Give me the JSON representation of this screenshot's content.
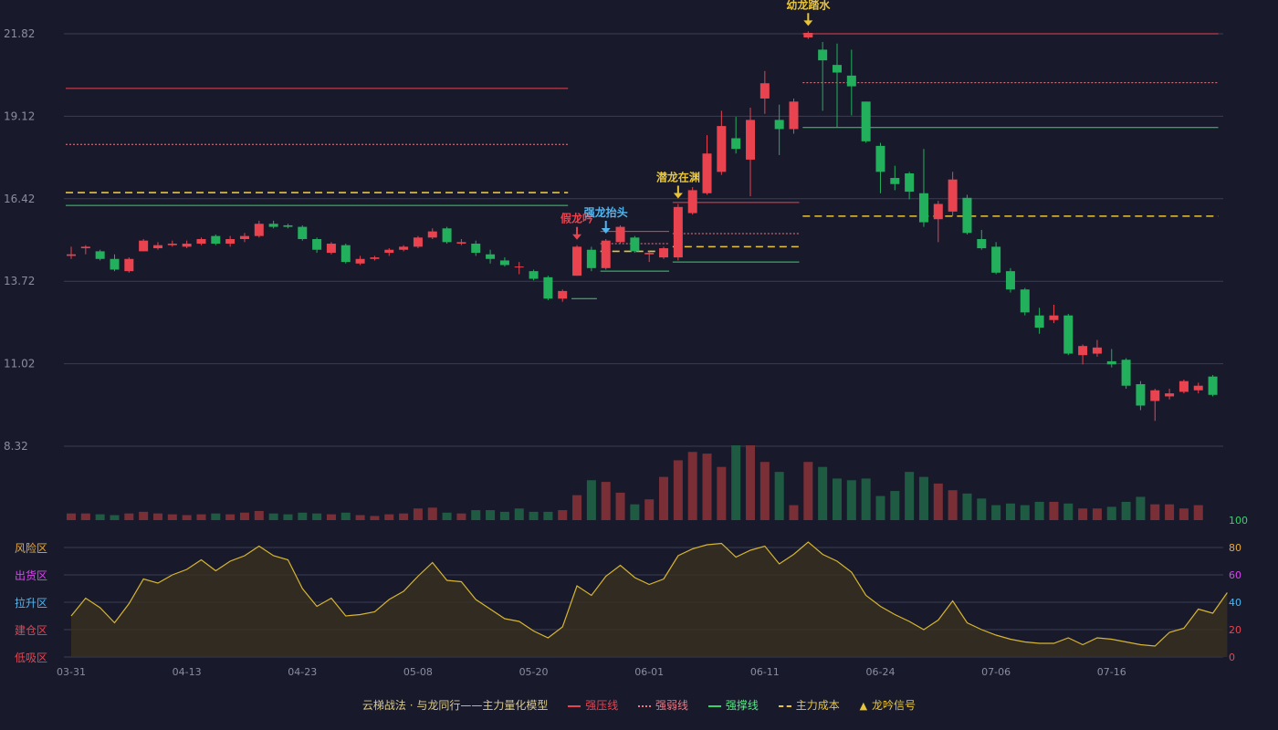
{
  "chart_data": {
    "type": "candlestick",
    "price_axis": {
      "ticks": [
        21.82,
        19.12,
        16.42,
        13.72,
        11.02,
        8.32
      ],
      "range": [
        8.32,
        21.82
      ]
    },
    "x_axis": {
      "labels": [
        "03-31",
        "04-13",
        "04-23",
        "05-08",
        "05-20",
        "06-01",
        "06-11",
        "06-24",
        "07-06",
        "07-16"
      ],
      "label_at_index": [
        0,
        8,
        16,
        24,
        32,
        40,
        48,
        56,
        64,
        72
      ]
    },
    "candles": [
      [
        14.55,
        14.6,
        14.85,
        14.45
      ],
      [
        14.8,
        14.85,
        14.9,
        14.6
      ],
      [
        14.7,
        14.45,
        14.75,
        14.4
      ],
      [
        14.45,
        14.1,
        14.6,
        14.05
      ],
      [
        14.05,
        14.45,
        14.5,
        14.0
      ],
      [
        14.7,
        15.05,
        15.1,
        14.7
      ],
      [
        14.8,
        14.9,
        15.0,
        14.75
      ],
      [
        14.9,
        14.95,
        15.05,
        14.85
      ],
      [
        14.85,
        14.95,
        15.05,
        14.8
      ],
      [
        14.95,
        15.1,
        15.15,
        14.9
      ],
      [
        15.2,
        14.95,
        15.25,
        14.9
      ],
      [
        14.95,
        15.1,
        15.2,
        14.85
      ],
      [
        15.1,
        15.2,
        15.3,
        15.0
      ],
      [
        15.2,
        15.6,
        15.7,
        15.15
      ],
      [
        15.6,
        15.5,
        15.7,
        15.45
      ],
      [
        15.55,
        15.5,
        15.6,
        15.45
      ],
      [
        15.5,
        15.1,
        15.55,
        15.05
      ],
      [
        15.1,
        14.75,
        15.15,
        14.65
      ],
      [
        14.65,
        14.95,
        15.0,
        14.6
      ],
      [
        14.9,
        14.35,
        14.95,
        14.3
      ],
      [
        14.3,
        14.45,
        14.55,
        14.25
      ],
      [
        14.45,
        14.5,
        14.55,
        14.4
      ],
      [
        14.65,
        14.75,
        14.8,
        14.55
      ],
      [
        14.75,
        14.85,
        14.9,
        14.7
      ],
      [
        14.85,
        15.15,
        15.2,
        14.8
      ],
      [
        15.15,
        15.35,
        15.45,
        15.1
      ],
      [
        15.45,
        15.0,
        15.5,
        14.95
      ],
      [
        14.95,
        15.0,
        15.1,
        14.9
      ],
      [
        14.95,
        14.65,
        15.05,
        14.55
      ],
      [
        14.6,
        14.45,
        14.75,
        14.3
      ],
      [
        14.4,
        14.25,
        14.5,
        14.2
      ],
      [
        14.2,
        14.2,
        14.35,
        13.95
      ],
      [
        14.05,
        13.8,
        14.1,
        13.75
      ],
      [
        13.85,
        13.15,
        13.9,
        13.1
      ],
      [
        13.15,
        13.4,
        13.45,
        13.05
      ],
      [
        13.9,
        14.85,
        14.9,
        13.9
      ],
      [
        14.75,
        14.15,
        14.85,
        14.05
      ],
      [
        14.15,
        15.05,
        15.1,
        14.1
      ],
      [
        15.0,
        15.5,
        15.55,
        14.95
      ],
      [
        15.15,
        14.7,
        15.2,
        14.65
      ],
      [
        14.6,
        14.65,
        14.7,
        14.35
      ],
      [
        14.5,
        14.8,
        14.85,
        14.45
      ],
      [
        14.5,
        16.15,
        16.25,
        14.4
      ],
      [
        15.95,
        16.7,
        16.8,
        15.9
      ],
      [
        16.6,
        17.9,
        18.5,
        16.55
      ],
      [
        17.3,
        18.8,
        19.3,
        17.2
      ],
      [
        18.4,
        18.05,
        19.1,
        17.9
      ],
      [
        17.7,
        19.0,
        19.4,
        16.5
      ],
      [
        19.7,
        20.2,
        20.6,
        19.2
      ],
      [
        19.0,
        18.7,
        19.5,
        17.85
      ],
      [
        18.7,
        19.6,
        19.7,
        18.55
      ],
      [
        21.7,
        21.85,
        21.9,
        21.65
      ],
      [
        21.3,
        20.95,
        21.55,
        19.3
      ],
      [
        20.8,
        20.55,
        21.5,
        18.75
      ],
      [
        20.45,
        20.1,
        21.3,
        19.15
      ],
      [
        19.6,
        18.3,
        19.6,
        18.25
      ],
      [
        18.15,
        17.3,
        18.25,
        16.6
      ],
      [
        17.1,
        16.9,
        17.5,
        16.7
      ],
      [
        17.25,
        16.65,
        17.3,
        16.4
      ],
      [
        16.6,
        15.65,
        18.05,
        15.5
      ],
      [
        15.75,
        16.25,
        16.35,
        15.0
      ],
      [
        16.0,
        17.05,
        17.3,
        15.85
      ],
      [
        16.45,
        15.3,
        16.55,
        15.25
      ],
      [
        15.1,
        14.8,
        15.4,
        14.75
      ],
      [
        14.85,
        14.0,
        15.0,
        13.95
      ],
      [
        14.05,
        13.45,
        14.15,
        13.35
      ],
      [
        13.45,
        12.7,
        13.5,
        12.6
      ],
      [
        12.6,
        12.2,
        12.85,
        12.0
      ],
      [
        12.45,
        12.6,
        12.95,
        12.35
      ],
      [
        12.6,
        11.35,
        12.65,
        11.3
      ],
      [
        11.3,
        11.6,
        11.65,
        11.0
      ],
      [
        11.35,
        11.55,
        11.8,
        11.25
      ],
      [
        11.1,
        11.0,
        11.5,
        10.9
      ],
      [
        11.15,
        10.3,
        11.2,
        10.2
      ],
      [
        10.35,
        9.65,
        10.45,
        9.5
      ],
      [
        9.8,
        10.15,
        10.2,
        9.15
      ],
      [
        9.95,
        10.05,
        10.2,
        9.85
      ],
      [
        10.1,
        10.45,
        10.5,
        10.05
      ],
      [
        10.15,
        10.3,
        10.4,
        10.05
      ],
      [
        10.6,
        10.0,
        10.65,
        9.95
      ]
    ],
    "volume": [
      8,
      8,
      7,
      6,
      8,
      10,
      8,
      7,
      6,
      7,
      8,
      7,
      9,
      11,
      8,
      7,
      9,
      8,
      7,
      9,
      6,
      5,
      7,
      8,
      14,
      15,
      9,
      8,
      12,
      12,
      10,
      14,
      10,
      10,
      12,
      30,
      48,
      46,
      33,
      19,
      25,
      52,
      72,
      82,
      80,
      64,
      90,
      90,
      70,
      58,
      18,
      70,
      64,
      50,
      48,
      50,
      29,
      35,
      58,
      52,
      44,
      36,
      32,
      26,
      18,
      20,
      18,
      22,
      22,
      20,
      14,
      14,
      16,
      22,
      28,
      19,
      19,
      14,
      18
    ],
    "volume_up": [
      1,
      1,
      0,
      0,
      1,
      1,
      1,
      1,
      1,
      1,
      0,
      1,
      1,
      1,
      0,
      0,
      0,
      0,
      1,
      0,
      1,
      1,
      1,
      1,
      1,
      1,
      0,
      1,
      0,
      0,
      0,
      0,
      0,
      0,
      1,
      1,
      0,
      1,
      1,
      0,
      1,
      1,
      1,
      1,
      1,
      1,
      0,
      1,
      1,
      0,
      1,
      1,
      0,
      0,
      0,
      0,
      0,
      0,
      0,
      0,
      1,
      1,
      0,
      0,
      0,
      0,
      0,
      0,
      1,
      0,
      1,
      1,
      0,
      0,
      0,
      1,
      1,
      1,
      1
    ],
    "oscillator": {
      "ticks": [
        0,
        20,
        40,
        60,
        80,
        100
      ],
      "zones": [
        "风险区",
        "出货区",
        "拉升区",
        "建仓区",
        "低吸区"
      ],
      "values": [
        30,
        43,
        36,
        25,
        39,
        57,
        54,
        60,
        64,
        71,
        63,
        70,
        74,
        81,
        74,
        71,
        50,
        37,
        43,
        30,
        31,
        33,
        42,
        48,
        59,
        69,
        56,
        55,
        42,
        35,
        28,
        26,
        19,
        14,
        22,
        52,
        45,
        59,
        67,
        58,
        53,
        57,
        74,
        79,
        82,
        83,
        73,
        78,
        81,
        68,
        75,
        84,
        75,
        70,
        62,
        45,
        37,
        31,
        26,
        20,
        27,
        41,
        25,
        20,
        16,
        13,
        11,
        10,
        10,
        14,
        9,
        14,
        13,
        11,
        9,
        8,
        18,
        21,
        35,
        32,
        47
      ]
    },
    "levels": [
      {
        "name": "强压线",
        "value": 20.03,
        "from": 0,
        "to": 34,
        "style": "solid",
        "color": "#e8434f"
      },
      {
        "name": "强弱线",
        "value": 18.2,
        "from": 0,
        "to": 34,
        "style": "dotted",
        "color": "#e87a86"
      },
      {
        "name": "主力成本",
        "value": 16.62,
        "from": 0,
        "to": 34,
        "style": "dashed",
        "color": "#e8c43a"
      },
      {
        "name": "强撑线",
        "value": 16.2,
        "from": 0,
        "to": 34,
        "style": "solid",
        "color": "#36d36b"
      },
      {
        "name": "强撑线",
        "value": 13.15,
        "from": 35,
        "to": 36,
        "style": "solid",
        "color": "#36d36b"
      },
      {
        "name": "强压线",
        "value": 15.35,
        "from": 37,
        "to": 41,
        "style": "solid",
        "color": "#e8434f"
      },
      {
        "name": "强弱线",
        "value": 14.95,
        "from": 37,
        "to": 41,
        "style": "dotted",
        "color": "#e87a86"
      },
      {
        "name": "主力成本",
        "value": 14.7,
        "from": 37,
        "to": 41,
        "style": "dashed",
        "color": "#e8c43a"
      },
      {
        "name": "强撑线",
        "value": 14.05,
        "from": 37,
        "to": 41,
        "style": "solid",
        "color": "#36d36b"
      },
      {
        "name": "强压线",
        "value": 16.3,
        "from": 42,
        "to": 50,
        "style": "solid",
        "color": "#e8434f"
      },
      {
        "name": "强弱线",
        "value": 15.28,
        "from": 42,
        "to": 50,
        "style": "dotted",
        "color": "#e87a86"
      },
      {
        "name": "主力成本",
        "value": 14.85,
        "from": 42,
        "to": 50,
        "style": "dashed",
        "color": "#e8c43a"
      },
      {
        "name": "强撑线",
        "value": 14.35,
        "from": 42,
        "to": 50,
        "style": "solid",
        "color": "#36d36b"
      },
      {
        "name": "强压线",
        "value": 21.82,
        "from": 51,
        "to": 79,
        "style": "solid",
        "color": "#e8434f"
      },
      {
        "name": "强弱线",
        "value": 20.22,
        "from": 51,
        "to": 79,
        "style": "dotted",
        "color": "#e87a86"
      },
      {
        "name": "强撑线",
        "value": 18.75,
        "from": 51,
        "to": 79,
        "style": "solid",
        "color": "#36d36b"
      },
      {
        "name": "主力成本",
        "value": 15.85,
        "from": 51,
        "to": 79,
        "style": "dashed",
        "color": "#e8c43a"
      }
    ],
    "signals": [
      {
        "index": 35,
        "label": "假龙吟",
        "color": "#e8434f"
      },
      {
        "index": 37,
        "label": "强龙抬头",
        "color": "#4fb6f0"
      },
      {
        "index": 42,
        "label": "潜龙在渊",
        "color": "#e8c43a"
      },
      {
        "index": 51,
        "label": "幼龙踏水",
        "color": "#e8c43a"
      }
    ],
    "legend": {
      "title": "云梯战法 · 与龙同行——主力量化模型",
      "items": [
        {
          "label": "强压线",
          "color": "#e8434f",
          "style": "solid"
        },
        {
          "label": "强弱线",
          "color": "#e87a86",
          "style": "dotted"
        },
        {
          "label": "强撑线",
          "color": "#36d36b",
          "style": "solid"
        },
        {
          "label": "主力成本",
          "color": "#e8c43a",
          "style": "dashed"
        },
        {
          "label": "龙吟信号",
          "color": "#e8c43a",
          "style": "triangle"
        }
      ]
    },
    "colors": {
      "up": "#e8434f",
      "down": "#22b05c",
      "grid": "#3a3d52",
      "axis_text": "#8a8da0",
      "osc_line": "#d7b530"
    }
  }
}
